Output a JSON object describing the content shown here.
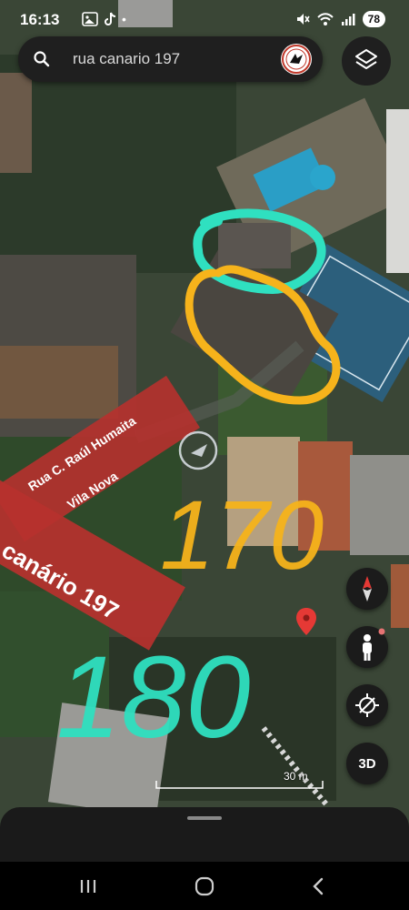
{
  "status_bar": {
    "time": "16:13",
    "battery": "78"
  },
  "search": {
    "query": "rua canario 197"
  },
  "map": {
    "street_label_line1": "Rua C. Raúl Humaita",
    "street_label_line2": "Vila Nova",
    "place_label": "canário 197",
    "handwritten_numbers": [
      "170",
      "180"
    ],
    "scale": "30 m"
  },
  "controls": {
    "three_d": "3D"
  },
  "colors": {
    "accent_red": "#b7312e",
    "annotation_yellow": "#f6b31b",
    "annotation_cyan": "#2fe0c0",
    "pin_red": "#e53935"
  }
}
